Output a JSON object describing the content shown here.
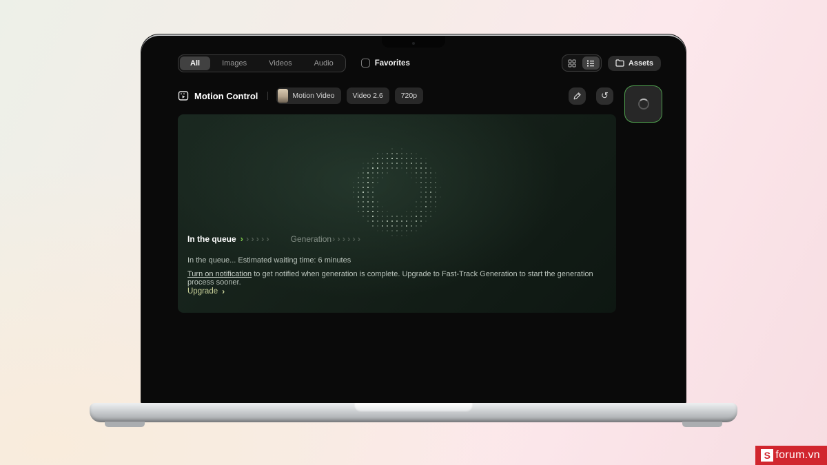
{
  "header": {
    "filter_tabs": [
      {
        "label": "All",
        "active": true
      },
      {
        "label": "Images",
        "active": false
      },
      {
        "label": "Videos",
        "active": false
      },
      {
        "label": "Audio",
        "active": false
      }
    ],
    "favorites_label": "Favorites",
    "assets_label": "Assets"
  },
  "generation": {
    "title": "Motion Control",
    "badges": {
      "model": "Motion Video",
      "version": "Video 2.6",
      "resolution": "720p"
    },
    "stages": {
      "queue_label": "In the queue",
      "generation_label": "Generation",
      "active_chevron": "›",
      "queue_trail": "›››››",
      "generation_trail": "››››››"
    },
    "status_line": "In the queue... Estimated waiting time: 6 minutes",
    "notification_link": "Turn on notification",
    "notification_rest": " to get notified when generation is complete. Upgrade to Fast-Track Generation to start the generation process sooner.",
    "upgrade_label": "Upgrade",
    "upgrade_chevron": "›"
  },
  "icons": {
    "redo_glyph": "↺"
  },
  "watermark": {
    "logo_letter": "S",
    "site": "forum.vn"
  },
  "colors": {
    "accent_green": "#7cc74a",
    "spinner_border": "#4f9e4e",
    "panel_green": "#15221b",
    "upgrade_text": "#ccd49c",
    "watermark_red": "#d1262e"
  }
}
